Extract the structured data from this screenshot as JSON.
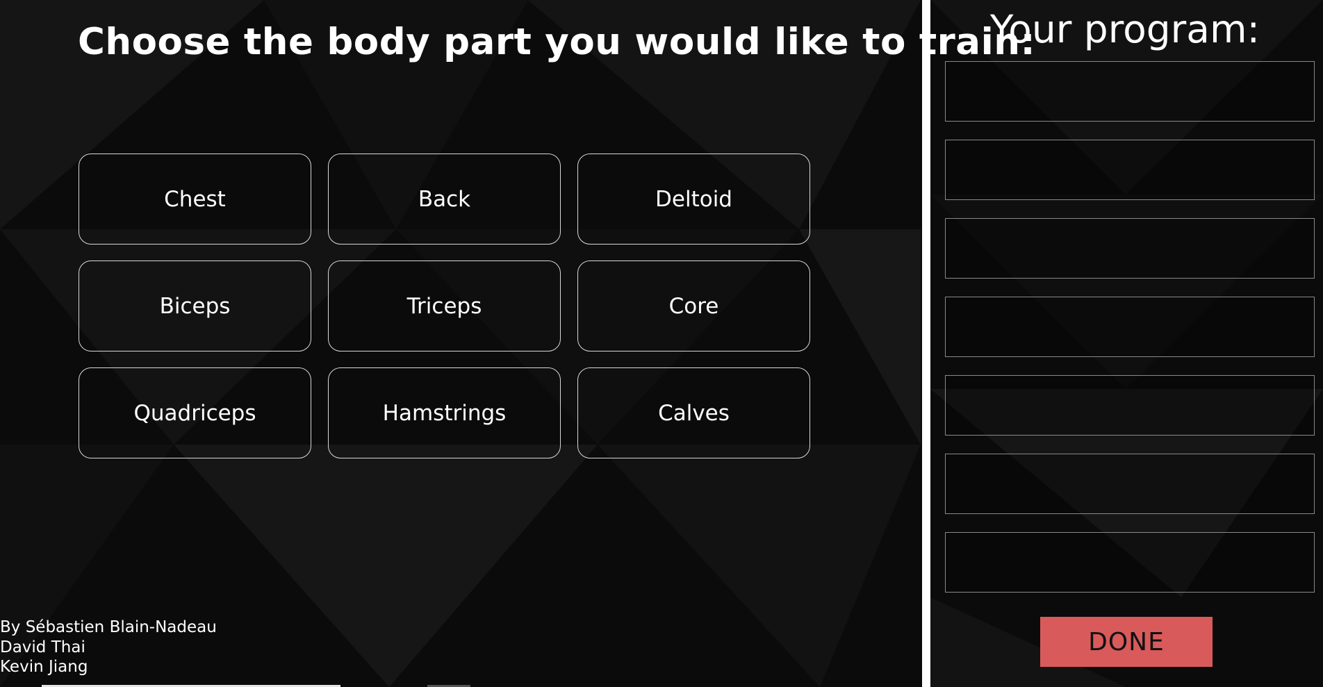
{
  "app": {
    "heading": "Choose the body part you would like to train:"
  },
  "body_parts": [
    {
      "label": "Chest"
    },
    {
      "label": "Back"
    },
    {
      "label": "Deltoid"
    },
    {
      "label": "Biceps"
    },
    {
      "label": "Triceps"
    },
    {
      "label": "Core"
    },
    {
      "label": "Quadriceps"
    },
    {
      "label": "Hamstrings"
    },
    {
      "label": "Calves"
    }
  ],
  "program": {
    "title": "Your program:",
    "slots": [
      "",
      "",
      "",
      "",
      "",
      "",
      ""
    ],
    "done_label": "DONE"
  },
  "credits": {
    "lines": [
      "By Sébastien Blain-Nadeau",
      "David Thai",
      "Kevin Jiang"
    ]
  },
  "colors": {
    "background": "#0b0b0b",
    "done_button": "#d95a5a",
    "button_border": "#d9d9d9",
    "divider": "#ffffff"
  }
}
